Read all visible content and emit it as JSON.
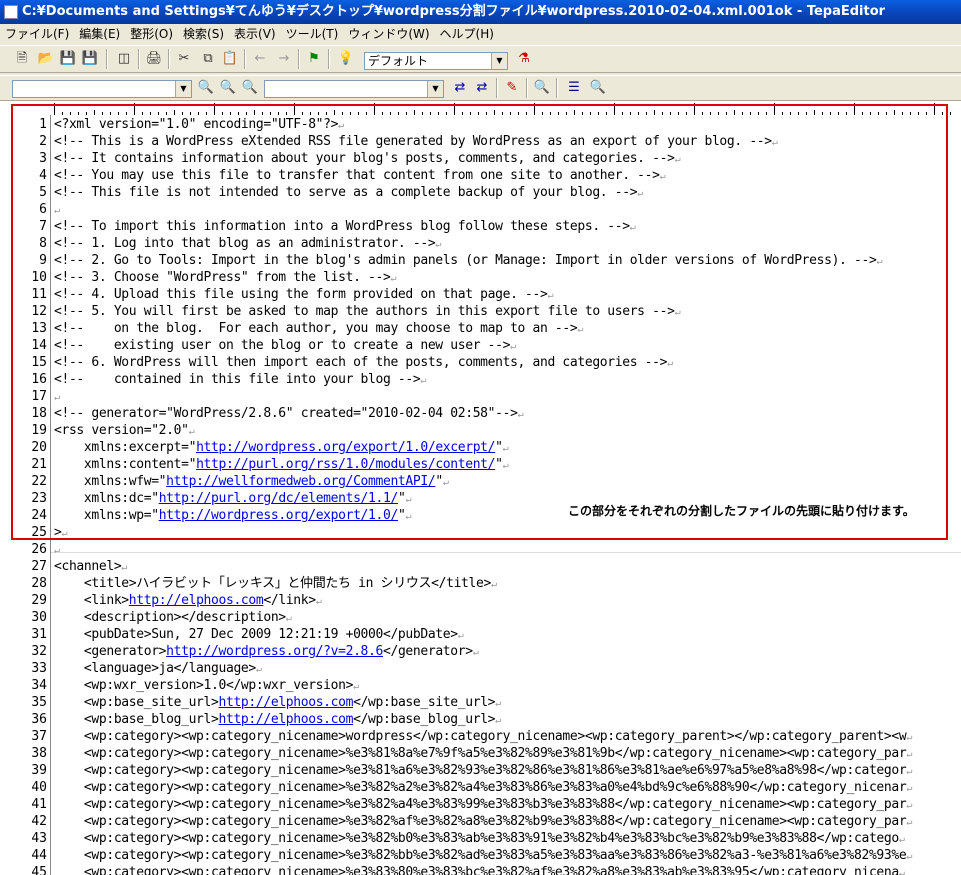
{
  "window": {
    "title": "C:¥Documents and Settings¥てんゆう¥デスクトップ¥wordpress分割ファイル¥wordpress.2010-02-04.xml.001ok - TepaEditor"
  },
  "menu": [
    "ファイル(F)",
    "編集(E)",
    "整形(O)",
    "検索(S)",
    "表示(V)",
    "ツール(T)",
    "ウィンドウ(W)",
    "ヘルプ(H)"
  ],
  "toolbar": {
    "font_combo": "デフォルト",
    "search_combo_1": "",
    "search_combo_2": ""
  },
  "annotation": "この部分をそれぞれの分割したファイルの先頭に貼り付けます。",
  "lines": [
    {
      "n": "1",
      "t": "<?xml version=\"1.0\" encoding=\"UTF-8\"?>"
    },
    {
      "n": "2",
      "t": "<!-- This is a WordPress eXtended RSS file generated by WordPress as an export of your blog. -->"
    },
    {
      "n": "3",
      "t": "<!-- It contains information about your blog's posts, comments, and categories. -->"
    },
    {
      "n": "4",
      "t": "<!-- You may use this file to transfer that content from one site to another. -->"
    },
    {
      "n": "5",
      "t": "<!-- This file is not intended to serve as a complete backup of your blog. -->"
    },
    {
      "n": "6",
      "t": ""
    },
    {
      "n": "7",
      "t": "<!-- To import this information into a WordPress blog follow these steps. -->"
    },
    {
      "n": "8",
      "t": "<!-- 1. Log into that blog as an administrator. -->"
    },
    {
      "n": "9",
      "t": "<!-- 2. Go to Tools: Import in the blog's admin panels (or Manage: Import in older versions of WordPress). -->"
    },
    {
      "n": "10",
      "t": "<!-- 3. Choose \"WordPress\" from the list. -->"
    },
    {
      "n": "11",
      "t": "<!-- 4. Upload this file using the form provided on that page. -->"
    },
    {
      "n": "12",
      "t": "<!-- 5. You will first be asked to map the authors in this export file to users -->"
    },
    {
      "n": "13",
      "t": "<!--    on the blog.  For each author, you may choose to map to an -->"
    },
    {
      "n": "14",
      "t": "<!--    existing user on the blog or to create a new user -->"
    },
    {
      "n": "15",
      "t": "<!-- 6. WordPress will then import each of the posts, comments, and categories -->"
    },
    {
      "n": "16",
      "t": "<!--    contained in this file into your blog -->"
    },
    {
      "n": "17",
      "t": ""
    },
    {
      "n": "18",
      "t": "<!-- generator=\"WordPress/2.8.6\" created=\"2010-02-04 02:58\"-->"
    },
    {
      "n": "19",
      "t": "<rss version=\"2.0\""
    },
    {
      "n": "20",
      "pre": "    xmlns:excerpt=\"",
      "url": "http://wordpress.org/export/1.0/excerpt/",
      "post": "\""
    },
    {
      "n": "21",
      "pre": "    xmlns:content=\"",
      "url": "http://purl.org/rss/1.0/modules/content/",
      "post": "\""
    },
    {
      "n": "22",
      "pre": "    xmlns:wfw=\"",
      "url": "http://wellformedweb.org/CommentAPI/",
      "post": "\""
    },
    {
      "n": "23",
      "pre": "    xmlns:dc=\"",
      "url": "http://purl.org/dc/elements/1.1/",
      "post": "\""
    },
    {
      "n": "24",
      "pre": "    xmlns:wp=\"",
      "url": "http://wordpress.org/export/1.0/",
      "post": "\""
    },
    {
      "n": "25",
      "t": ">"
    },
    {
      "n": "26",
      "t": ""
    },
    {
      "n": "27",
      "t": "<channel>"
    },
    {
      "n": "28",
      "t": "    <title>ハイラビット「レッキス」と仲間たち in シリウス</title>"
    },
    {
      "n": "29",
      "pre": "    <link>",
      "url": "http://elphoos.com",
      "post": "</link>"
    },
    {
      "n": "30",
      "t": "    <description></description>"
    },
    {
      "n": "31",
      "t": "    <pubDate>Sun, 27 Dec 2009 12:21:19 +0000</pubDate>"
    },
    {
      "n": "32",
      "pre": "    <generator>",
      "url": "http://wordpress.org/?v=2.8.6",
      "post": "</generator>"
    },
    {
      "n": "33",
      "t": "    <language>ja</language>"
    },
    {
      "n": "34",
      "t": "    <wp:wxr_version>1.0</wp:wxr_version>"
    },
    {
      "n": "35",
      "pre": "    <wp:base_site_url>",
      "url": "http://elphoos.com",
      "post": "</wp:base_site_url>"
    },
    {
      "n": "36",
      "pre": "    <wp:base_blog_url>",
      "url": "http://elphoos.com",
      "post": "</wp:base_blog_url>"
    },
    {
      "n": "37",
      "t": "    <wp:category><wp:category_nicename>wordpress</wp:category_nicename><wp:category_parent></wp:category_parent><w"
    },
    {
      "n": "38",
      "t": "    <wp:category><wp:category_nicename>%e3%81%8a%e7%9f%a5%e3%82%89%e3%81%9b</wp:category_nicename><wp:category_par"
    },
    {
      "n": "39",
      "t": "    <wp:category><wp:category_nicename>%e3%81%a6%e3%82%93%e3%82%86%e3%81%86%e3%81%ae%e6%97%a5%e8%a8%98</wp:categor"
    },
    {
      "n": "40",
      "t": "    <wp:category><wp:category_nicename>%e3%82%a2%e3%82%a4%e3%83%86%e3%83%a0%e4%bd%9c%e6%88%90</wp:category_nicenar"
    },
    {
      "n": "41",
      "t": "    <wp:category><wp:category_nicename>%e3%82%a4%e3%83%99%e3%83%b3%e3%83%88</wp:category_nicename><wp:category_par"
    },
    {
      "n": "42",
      "t": "    <wp:category><wp:category_nicename>%e3%82%af%e3%82%a8%e3%82%b9%e3%83%88</wp:category_nicename><wp:category_par"
    },
    {
      "n": "43",
      "t": "    <wp:category><wp:category_nicename>%e3%82%b0%e3%83%ab%e3%83%91%e3%82%b4%e3%83%bc%e3%82%b9%e3%83%88</wp:catego"
    },
    {
      "n": "44",
      "t": "    <wp:category><wp:category_nicename>%e3%82%bb%e3%82%ad%e3%83%a5%e3%83%aa%e3%83%86%e3%82%a3-%e3%81%a6%e3%82%93%e"
    },
    {
      "n": "45",
      "t": "    <wp:category><wp:category_nicename>%e3%83%80%e3%83%bc%e3%82%af%e3%82%a8%e3%83%ab%e3%83%95</wp:category_nicena"
    }
  ]
}
